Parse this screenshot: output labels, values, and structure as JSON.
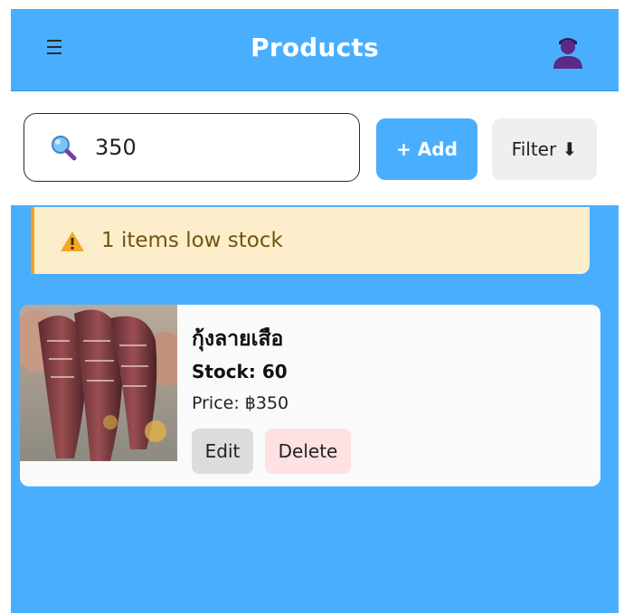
{
  "header": {
    "title": "Products",
    "menu_icon": "hamburger-menu-icon",
    "avatar_icon": "user-avatar-icon"
  },
  "toolbar": {
    "search_icon": "search-icon",
    "search_value": "350",
    "add_label": "+ Add",
    "filter_label": "Filter ⬇"
  },
  "alert": {
    "icon": "warning-icon",
    "text": "1 items low stock"
  },
  "products": [
    {
      "name": "กุ้งลายเสือ",
      "stock": "Stock: 60",
      "price": "Price: ฿350",
      "edit_label": "Edit",
      "delete_label": "Delete"
    }
  ],
  "colors": {
    "accent": "#4aaeff",
    "alert_bg": "#fdeecb",
    "alert_border": "#f0a21c",
    "delete_bg": "#ffe0e3"
  }
}
